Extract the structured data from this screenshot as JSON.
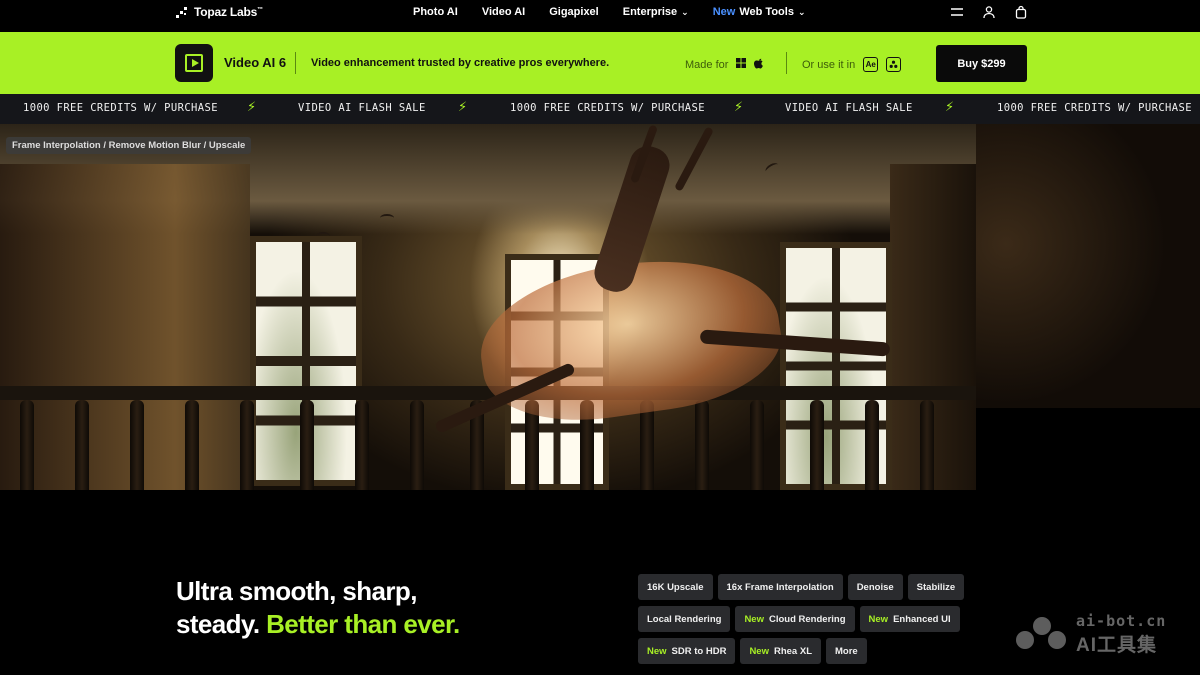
{
  "topnav": {
    "logo_text": "Topaz Labs",
    "logo_tm": "™",
    "links": [
      {
        "label": "Photo AI"
      },
      {
        "label": "Video AI"
      },
      {
        "label": "Gigapixel"
      },
      {
        "label": "Enterprise"
      },
      {
        "badge": "New",
        "label": "Web Tools"
      }
    ],
    "icons": [
      "menu-icon",
      "user-icon",
      "cart-icon"
    ]
  },
  "productbar": {
    "app_name": "Video AI 6",
    "tagline": "Video enhancement trusted by creative pros everywhere.",
    "made_for_label": "Made for",
    "or_use_label": "Or use it in",
    "plugin_ae": "Ae",
    "buy_label": "Buy  $299",
    "accent_color": "#a8f025"
  },
  "ticker": {
    "items": [
      "1000 FREE CREDITS W/ PURCHASE",
      "VIDEO AI FLASH SALE",
      "1000 FREE CREDITS W/ PURCHASE",
      "VIDEO AI FLASH SALE",
      "1000 FREE CREDITS W/ PURCHASE"
    ]
  },
  "hero": {
    "caption": "Frame Interpolation / Remove Motion Blur / Upscale"
  },
  "headline": {
    "line1": "Ultra smooth, sharp,",
    "line2_prefix": "steady.",
    "line2_accent": "Better than ever."
  },
  "features": {
    "rows": [
      [
        {
          "label": "16K Upscale"
        },
        {
          "label": "16x Frame Interpolation"
        },
        {
          "label": "Denoise"
        },
        {
          "label": "Stabilize"
        }
      ],
      [
        {
          "label": "Local Rendering"
        },
        {
          "badge": "New",
          "label": "Cloud Rendering"
        },
        {
          "badge": "New",
          "label": "Enhanced UI"
        }
      ],
      [
        {
          "badge": "New",
          "label": "SDR to HDR"
        },
        {
          "badge": "New",
          "label": "Rhea XL"
        },
        {
          "label": "More"
        }
      ]
    ]
  },
  "watermark": {
    "line1": "ai-bot.cn",
    "line2": "AI工具集"
  }
}
